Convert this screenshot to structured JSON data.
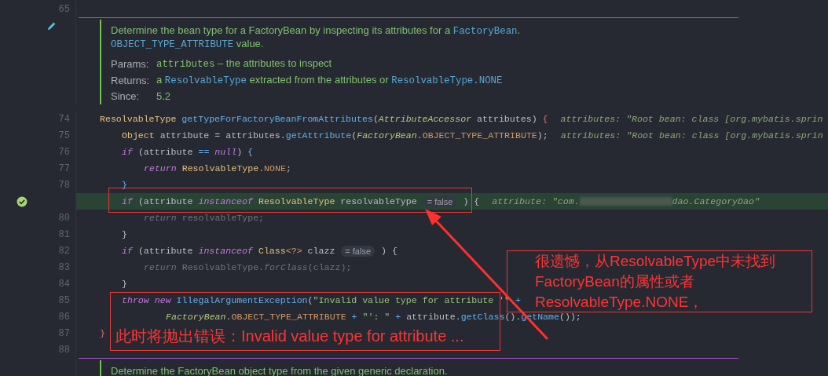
{
  "top_line": {
    "number": "65"
  },
  "doc_top": {
    "paragraph": [
      [
        {
          "kind": "text",
          "text": "Determine the bean type for a FactoryBean by inspecting its attributes for a "
        },
        {
          "kind": "code",
          "text": "FactoryBean"
        },
        {
          "kind": "text",
          "text": "."
        }
      ],
      [
        {
          "kind": "code",
          "text": "OBJECT_TYPE_ATTRIBUTE"
        },
        {
          "kind": "text",
          "text": " value."
        }
      ]
    ],
    "fields": [
      {
        "label": "Params:",
        "value": [
          {
            "kind": "param",
            "text": "attributes"
          },
          {
            "kind": "text",
            "text": " – the attributes to inspect"
          }
        ]
      },
      {
        "label": "Returns:",
        "value": [
          {
            "kind": "text",
            "text": "a "
          },
          {
            "kind": "code",
            "text": "ResolvableType"
          },
          {
            "kind": "text",
            "text": " extracted from the attributes or "
          },
          {
            "kind": "code",
            "text": "ResolvableType.NONE"
          }
        ]
      },
      {
        "label": "Since:",
        "value": [
          {
            "kind": "text",
            "text": "5.2"
          }
        ]
      }
    ]
  },
  "lines": [
    {
      "number": "74",
      "highlighted": false,
      "breakpoint_hit": false,
      "tokens": [
        {
          "kind": "type",
          "text": "ResolvableType"
        },
        {
          "kind": "method",
          "text": " getTypeForFactoryBeanFromAttributes"
        },
        {
          "kind": "plain",
          "text": "("
        },
        {
          "kind": "itype",
          "text": "AttributeAccessor"
        },
        {
          "kind": "plain",
          "text": " attributes) "
        },
        {
          "kind": "rbrace",
          "text": "{"
        }
      ],
      "hint": [
        {
          "kind": "text",
          "text": "attributes: \"Root bean: class [org.mybatis.sprin"
        }
      ],
      "children": [
        {
          "number": "75",
          "highlighted": false,
          "breakpoint_hit": false,
          "tokens": [
            {
              "kind": "type",
              "text": "Object"
            },
            {
              "kind": "plain",
              "text": " attribute = attributes."
            },
            {
              "kind": "method",
              "text": "getAttribute"
            },
            {
              "kind": "plain",
              "text": "("
            },
            {
              "kind": "itype",
              "text": "FactoryBean"
            },
            {
              "kind": "plain",
              "text": "."
            },
            {
              "kind": "field",
              "text": "OBJECT_TYPE_ATTRIBUTE"
            },
            {
              "kind": "plain",
              "text": ");"
            }
          ],
          "hint": [
            {
              "kind": "text",
              "text": "attributes: \"Root bean: class [org.mybatis.sprin"
            }
          ]
        },
        {
          "number": "76",
          "highlighted": false,
          "breakpoint_hit": false,
          "tokens": [
            {
              "kind": "keyword",
              "text": "if"
            },
            {
              "kind": "plain",
              "text": " (attribute "
            },
            {
              "kind": "method",
              "text": "== "
            },
            {
              "kind": "keyword",
              "text": "null"
            },
            {
              "kind": "plain",
              "text": ") "
            },
            {
              "kind": "bbrace",
              "text": "{"
            }
          ],
          "children": [
            {
              "number": "77",
              "highlighted": false,
              "breakpoint_hit": false,
              "tokens": [
                {
                  "kind": "keyword",
                  "text": "return"
                },
                {
                  "kind": "type",
                  "text": " ResolvableType"
                },
                {
                  "kind": "plain",
                  "text": "."
                },
                {
                  "kind": "field",
                  "text": "NONE"
                },
                {
                  "kind": "plain",
                  "text": ";"
                }
              ]
            }
          ]
        },
        {
          "number": "78",
          "highlighted": false,
          "breakpoint_hit": false,
          "tokens": [
            {
              "kind": "bbrace",
              "text": "}"
            }
          ]
        },
        {
          "highlighted": true,
          "breakpoint_hit": true,
          "tokens": [
            {
              "kind": "keyword",
              "text": "if"
            },
            {
              "kind": "plain",
              "text": " (attribute "
            },
            {
              "kind": "keyword",
              "text": "instanceof"
            },
            {
              "kind": "type",
              "text": " ResolvableType"
            },
            {
              "kind": "plain",
              "text": " resolvableType "
            },
            {
              "kind": "inlay",
              "text": "= false"
            },
            {
              "kind": "plain",
              "text": " ) {"
            }
          ],
          "hint": [
            {
              "kind": "text",
              "text": "attribute: \"com."
            },
            {
              "kind": "redacted"
            },
            {
              "kind": "text",
              "text": "dao.CategoryDao\""
            }
          ],
          "children": [
            {
              "number": "80",
              "highlighted": false,
              "breakpoint_hit": false,
              "tokens": [
                {
                  "kind": "dimkeyword",
                  "text": "return"
                },
                {
                  "kind": "dim",
                  "text": " resolvableType;"
                }
              ]
            }
          ]
        },
        {
          "number": "81",
          "highlighted": false,
          "breakpoint_hit": false,
          "tokens": [
            {
              "kind": "plain",
              "text": "}"
            }
          ]
        },
        {
          "number": "82",
          "highlighted": false,
          "breakpoint_hit": false,
          "tokens": [
            {
              "kind": "keyword",
              "text": "if"
            },
            {
              "kind": "plain",
              "text": " (attribute "
            },
            {
              "kind": "keyword",
              "text": "instanceof"
            },
            {
              "kind": "type",
              "text": " Class"
            },
            {
              "kind": "field",
              "text": "<?>"
            },
            {
              "kind": "plain",
              "text": " clazz "
            },
            {
              "kind": "inlay",
              "text": "= false"
            },
            {
              "kind": "plain",
              "text": " ) {"
            }
          ],
          "children": [
            {
              "number": "83",
              "highlighted": false,
              "breakpoint_hit": false,
              "tokens": [
                {
                  "kind": "dimkeyword",
                  "text": "return"
                },
                {
                  "kind": "dim",
                  "text": " ResolvableType."
                },
                {
                  "kind": "dimkeyword",
                  "text": "forClass"
                },
                {
                  "kind": "dim",
                  "text": "(clazz);"
                }
              ]
            }
          ]
        },
        {
          "number": "84",
          "highlighted": false,
          "breakpoint_hit": false,
          "tokens": [
            {
              "kind": "plain",
              "text": "}"
            }
          ]
        },
        {
          "number": "85",
          "highlighted": false,
          "breakpoint_hit": false,
          "tokens": [
            {
              "kind": "keyword",
              "text": "throw"
            },
            {
              "kind": "keyword",
              "text": " new"
            },
            {
              "kind": "method",
              "text": " IllegalArgumentException"
            },
            {
              "kind": "plain",
              "text": "("
            },
            {
              "kind": "string",
              "text": "\"Invalid value type for attribute '\""
            },
            {
              "kind": "method",
              "text": " +"
            }
          ],
          "children": [
            {
              "number": "86",
              "kind": "continuation",
              "highlighted": false,
              "breakpoint_hit": false,
              "tokens": [
                {
                  "kind": "itype",
                  "text": "FactoryBean"
                },
                {
                  "kind": "plain",
                  "text": "."
                },
                {
                  "kind": "field",
                  "text": "OBJECT_TYPE_ATTRIBUTE"
                },
                {
                  "kind": "method",
                  "text": " + "
                },
                {
                  "kind": "string",
                  "text": "\"': \""
                },
                {
                  "kind": "method",
                  "text": " + "
                },
                {
                  "kind": "plain",
                  "text": "attribute."
                },
                {
                  "kind": "method",
                  "text": "getClass"
                },
                {
                  "kind": "plain",
                  "text": "()."
                },
                {
                  "kind": "method",
                  "text": "getName"
                },
                {
                  "kind": "plain",
                  "text": "());"
                }
              ]
            }
          ]
        }
      ]
    },
    {
      "number": "87",
      "highlighted": false,
      "breakpoint_hit": false,
      "tokens": [
        {
          "kind": "rbrace",
          "text": "}"
        }
      ]
    },
    {
      "number": "88",
      "highlighted": false,
      "breakpoint_hit": false
    }
  ],
  "doc_bottom": {
    "paragraph": [
      [
        {
          "kind": "text",
          "text": "Determine the FactoryBean object type from the given generic declaration."
        }
      ]
    ]
  },
  "annotations": [
    {
      "kind": "frame"
    },
    {
      "kind": "frame",
      "text": "此时将抛出错误：Invalid value type for attribute ..."
    },
    {
      "kind": "note",
      "lines": [
        "很遗憾，从ResolvableType中未找到",
        "FactoryBean的属性或者",
        "ResolvableType.NONE，"
      ]
    },
    {
      "kind": "arrow"
    }
  ]
}
